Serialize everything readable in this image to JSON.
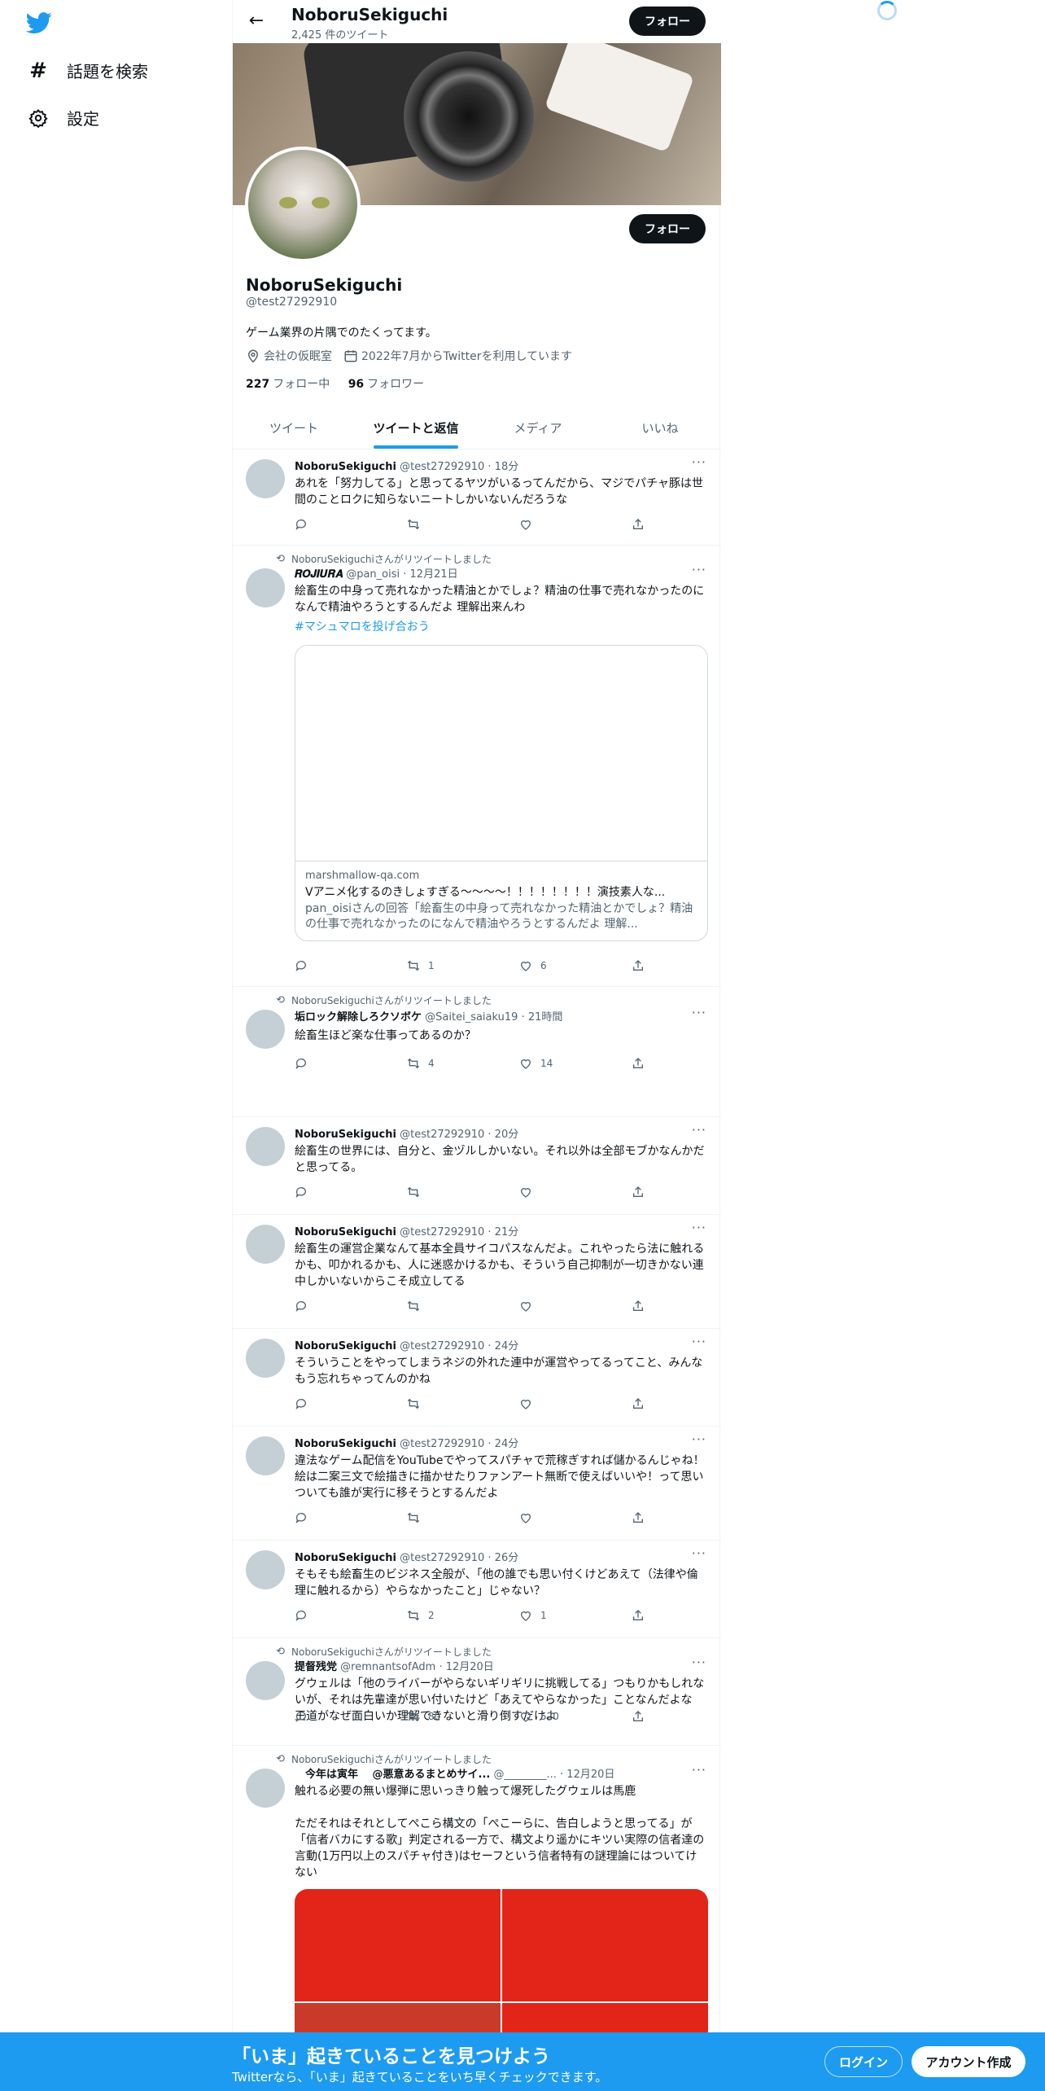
{
  "nav": {
    "explore": "話題を検索",
    "settings": "設定"
  },
  "header": {
    "name": "NoboruSekiguchi",
    "tweet_count": "2,425 件のツイート",
    "follow": "フォロー"
  },
  "profile": {
    "name": "NoboruSekiguchi",
    "handle": "@test27292910",
    "bio": "ゲーム業界の片隅でのたくってます。",
    "location": "会社の仮眠室",
    "joined": "2022年7月からTwitterを利用しています",
    "following_count": "227",
    "following_label": "フォロー中",
    "followers_count": "96",
    "followers_label": "フォロワー",
    "follow": "フォロー"
  },
  "tabs": [
    "ツイート",
    "ツイートと返信",
    "メディア",
    "いいね"
  ],
  "tweets": [
    {
      "name": "NoboruSekiguchi",
      "handle": "@test27292910",
      "time": "· 18分",
      "text": "あれを「努力してる」と思ってるヤツがいるってんだから、マジでパチャ豚は世間のことロクに知らないニートしかいないんだろうな",
      "rt": "",
      "replies": "",
      "retweets": "",
      "likes": ""
    },
    {
      "rt": "NoboruSekiguchiさんがリツイートしました",
      "name": "𝑹𝑶𝑱𝑰𝑼𝑹𝑨",
      "handle": "@pan_oisi",
      "time": "· 12月21日",
      "text": "絵畜生の中身って売れなかった精油とかでしょ？精油の仕事で売れなかったのになんで精油やろうとするんだよ 理解出来んわ",
      "hashtag": "#マシュマロを投げ合おう",
      "card_domain": "marshmallow-qa.com",
      "card_title": "Vアニメ化するのきしょすぎる〜〜〜〜！！！！！！！！演技素人な...",
      "card_desc": "pan_oisiさんの回答「絵畜生の中身って売れなかった精油とかでしょ？精油の仕事で売れなかったのになんで精油やろうとするんだよ 理解...",
      "replies": "",
      "retweets": "1",
      "likes": "6"
    },
    {
      "rt": "NoboruSekiguchiさんがリツイートしました",
      "name": "垢ロック解除しろクソボケ",
      "handle": "@Saitei_saiaku19",
      "time": "· 21時間",
      "text": "絵畜生ほど楽な仕事ってあるのか？",
      "replies": "",
      "retweets": "4",
      "likes": "14"
    },
    {
      "name": "NoboruSekiguchi",
      "handle": "@test27292910",
      "time": "· 20分",
      "text": "絵畜生の世界には、自分と、金ヅルしかいない。それ以外は全部モブかなんかだと思ってる。",
      "rt": "",
      "replies": "",
      "retweets": "",
      "likes": ""
    },
    {
      "name": "NoboruSekiguchi",
      "handle": "@test27292910",
      "time": "· 21分",
      "text": "絵畜生の運営企業なんて基本全員サイコパスなんだよ。これやったら法に触れるかも、叩かれるかも、人に迷惑かけるかも、そういう自己抑制が一切きかない連中しかいないからこそ成立してる",
      "rt": "",
      "replies": "",
      "retweets": "",
      "likes": ""
    },
    {
      "name": "NoboruSekiguchi",
      "handle": "@test27292910",
      "time": "· 24分",
      "text": "そういうことをやってしまうネジの外れた連中が運営やってるってこと、みんなもう忘れちゃってんのかね",
      "rt": "",
      "replies": "",
      "retweets": "",
      "likes": ""
    },
    {
      "name": "NoboruSekiguchi",
      "handle": "@test27292910",
      "time": "· 24分",
      "text": "違法なゲーム配信をYouTubeでやってスパチャで荒稼ぎすれば儲かるんじゃね！絵は二案三文で絵描きに描かせたりファンアート無断で使えばいいや！って思いついても誰が実行に移そうとするんだよ",
      "rt": "",
      "replies": "",
      "retweets": "",
      "likes": ""
    },
    {
      "name": "NoboruSekiguchi",
      "handle": "@test27292910",
      "time": "· 26分",
      "text": "そもそも絵畜生のビジネス全般が、「他の誰でも思い付くけどあえて（法律や倫理に触れるから）やらなかったこと」じゃない？",
      "rt": "",
      "replies": "",
      "retweets": "2",
      "likes": "1"
    },
    {
      "rt": "NoboruSekiguchiさんがリツイートしました",
      "name": "提督残党",
      "handle": "@remnantsofAdm",
      "time": "· 12月20日",
      "text": "グウェルは「他のライバーがやらないギリギリに挑戦してる」つもりかもしれないが、それは先輩達が思い付いたけど「あえてやらなかった」ことなんだよな\n王道がなぜ面白いか理解できないと滑り倒すだけよ",
      "replies": "",
      "retweets": "80",
      "likes": "520"
    },
    {
      "rt": "NoboruSekiguchiさんがリツイートしました",
      "name": "　今年は寅年　 @悪意あるまとめサイ...",
      "handle": "@________...",
      "time": "· 12月20日",
      "text": "触れる必要の無い爆弾に思いっきり触って爆死したグウェルは馬鹿\n\nただそれはそれとしてぺこら構文の「ぺこーらに、告白しようと思ってる」が「信者バカにする歌」判定される一方で、構文より遥かにキツい実際の信者達の言動(1万円以上のスパチャ付き)はセーフという信者特有の謎理論にはついてけない"
    }
  ],
  "bottom": {
    "title": "「いま」起きていることを見つけよう",
    "subtitle": "Twitterなら、「いま」起きていることをいち早くチェックできます。",
    "login": "ログイン",
    "signup": "アカウント作成"
  },
  "colors": {
    "accent": "#1d9bf0",
    "text": "#0f1419",
    "muted": "#536471",
    "border": "#eff3f4"
  }
}
